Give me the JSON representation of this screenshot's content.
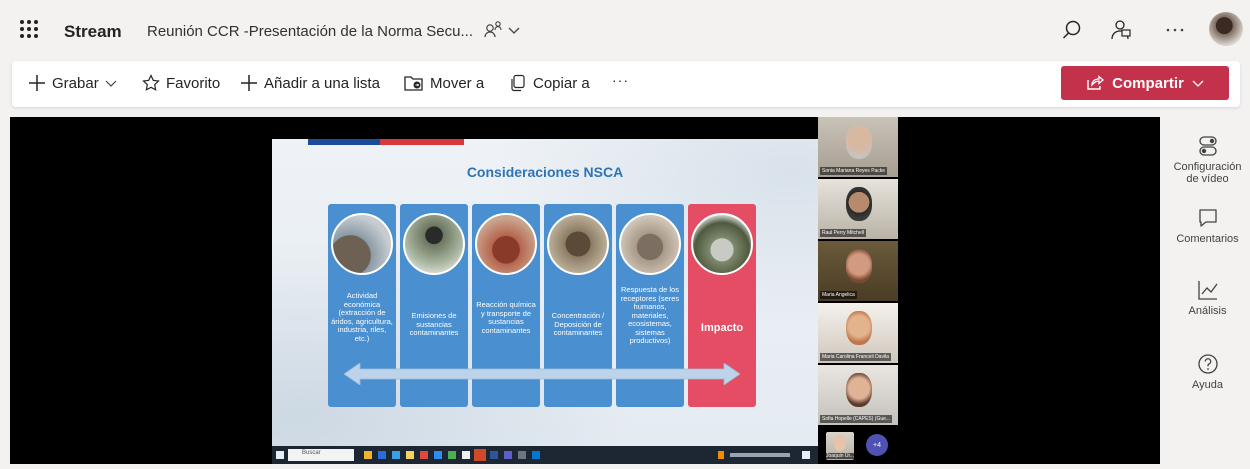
{
  "header": {
    "app_name": "Stream",
    "video_title": "Reunión CCR -Presentación de la Norma Secu...",
    "icons": [
      "waffle-icon",
      "people-icon",
      "chevron-down-icon",
      "search-icon",
      "feedback-icon",
      "more-icon",
      "avatar"
    ]
  },
  "toolbar": {
    "record": "Grabar",
    "favorite": "Favorito",
    "add_to_list": "Añadir a una lista",
    "move_to": "Mover a",
    "copy_to": "Copiar a",
    "more": "···",
    "share": "Compartir"
  },
  "slide": {
    "title": "Consideraciones NSCA",
    "columns": [
      {
        "text": "Actividad económica (extracción de áridos, agricultura, industria, riles, etc.)"
      },
      {
        "text": "Emisiones de sustancias contaminantes"
      },
      {
        "text": "Reacción química y transporte de sustancias contaminantes"
      },
      {
        "text": "Concentración / Deposición de contaminantes"
      },
      {
        "text": "Respuesta de los receptores (seres humanos, materiales, ecosistemas, sistemas productivos)"
      },
      {
        "text": "Impacto"
      }
    ],
    "taskbar_search": "Buscar"
  },
  "participants": [
    {
      "name": "Sonia Mariana Reyes Packe"
    },
    {
      "name": "Raul Perry Mitchell"
    },
    {
      "name": "Maria Angelica"
    },
    {
      "name": "Maria Carolina Franceli Davila"
    },
    {
      "name": "Sofia Hopelle (CAPES) (Gue..."
    }
  ],
  "more_participants": "+4",
  "mini_participant": "Joaquin Ur...",
  "right_rail": {
    "video_settings": "Configuración de vídeo",
    "comments": "Comentarios",
    "analytics": "Análisis",
    "help": "Ayuda"
  },
  "colors": {
    "share": "#c4314b",
    "slide_blue": "#4a8fcf",
    "slide_red": "#e44d63",
    "title_blue": "#2e74b5"
  }
}
